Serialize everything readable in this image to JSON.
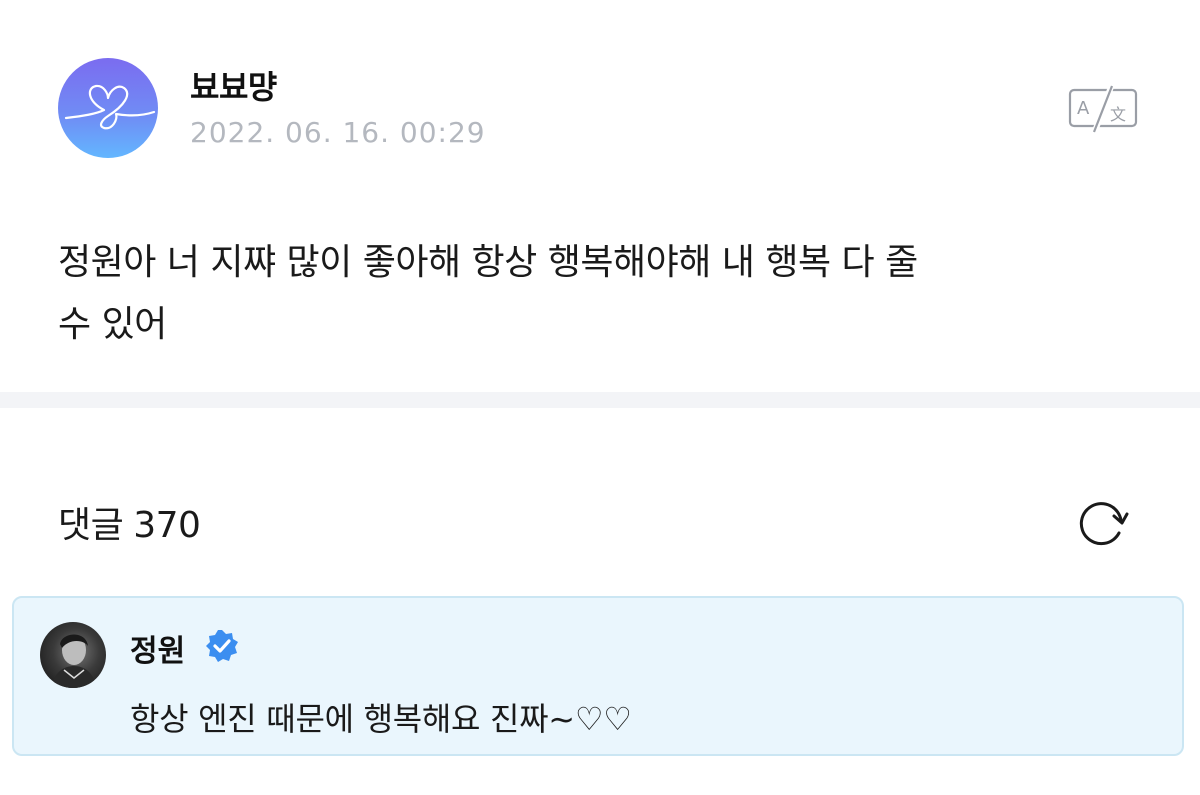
{
  "post": {
    "author": "뵤뵤먕",
    "date": "2022. 06. 16. 00:29",
    "body_line1": "정원아 너 지쨔 많이 좋아해 항상 행복해야해 내 행복 다 줄",
    "body_line2": "수 있어",
    "avatar_icon": "heart-scribble-icon",
    "translate_icon": "translate-icon"
  },
  "comments": {
    "label": "댓글",
    "count": "370",
    "refresh_icon": "refresh-icon"
  },
  "highlight_comment": {
    "author": "정원",
    "verified_icon": "verified-badge-icon",
    "text": "항상 엔진 때문에 행복해요 진짜~♡♡"
  },
  "colors": {
    "verified": "#3b8ef0",
    "highlight_bg": "#eaf6fd",
    "highlight_border": "#cbe6f3",
    "date_text": "#b4b8bf",
    "divider": "#f3f4f7"
  }
}
